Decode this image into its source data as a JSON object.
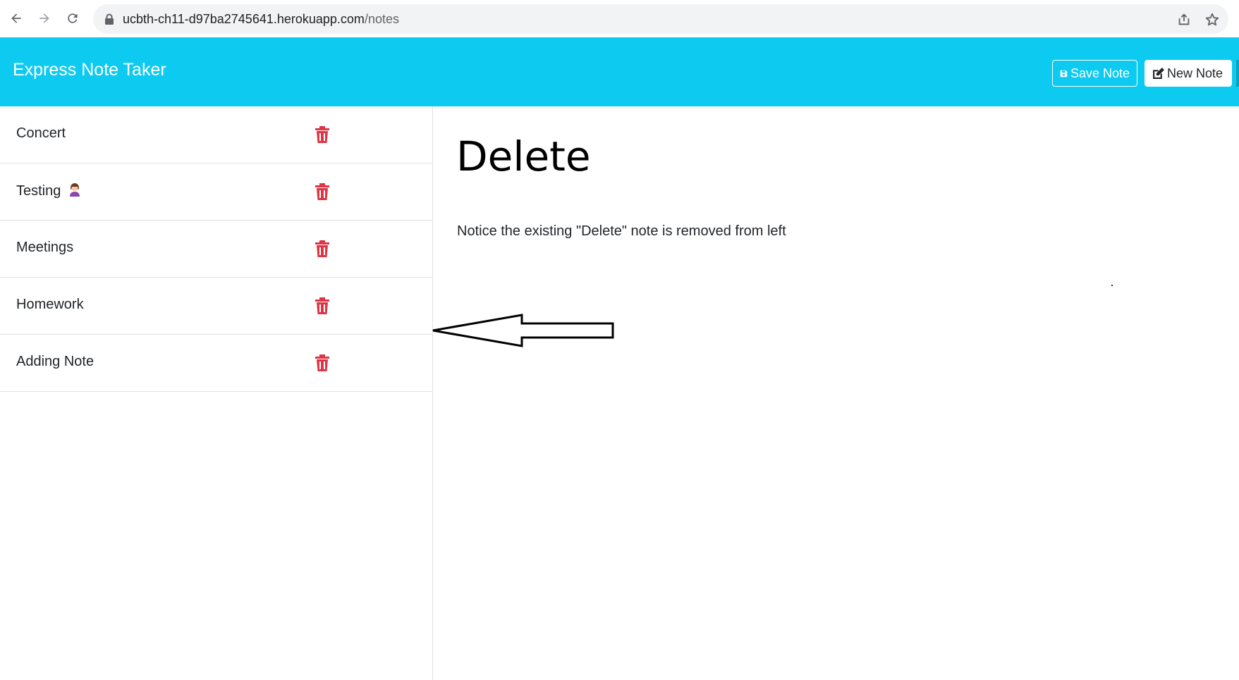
{
  "browser": {
    "url_host": "ucbth-ch11-d97ba2745641.herokuapp.com",
    "url_path": "/notes"
  },
  "header": {
    "brand": "Express Note Taker",
    "save_label": "Save Note",
    "new_label": "New Note"
  },
  "notes": [
    {
      "title": "Concert"
    },
    {
      "title": "Testing"
    },
    {
      "title": "Meetings"
    },
    {
      "title": "Homework"
    },
    {
      "title": "Adding Note"
    }
  ],
  "active_note": {
    "title": "Delete",
    "text": "Notice the existing \"Delete\" note is removed from left"
  },
  "colors": {
    "header_bg": "#0dcaf0",
    "trash": "#dc3545"
  },
  "icons": {
    "back": "arrow-left-icon",
    "forward": "arrow-right-icon",
    "reload": "reload-icon",
    "lock": "lock-icon",
    "share": "share-icon",
    "star": "star-icon",
    "save": "floppy-icon",
    "new": "edit-icon",
    "delete": "trash-icon"
  }
}
